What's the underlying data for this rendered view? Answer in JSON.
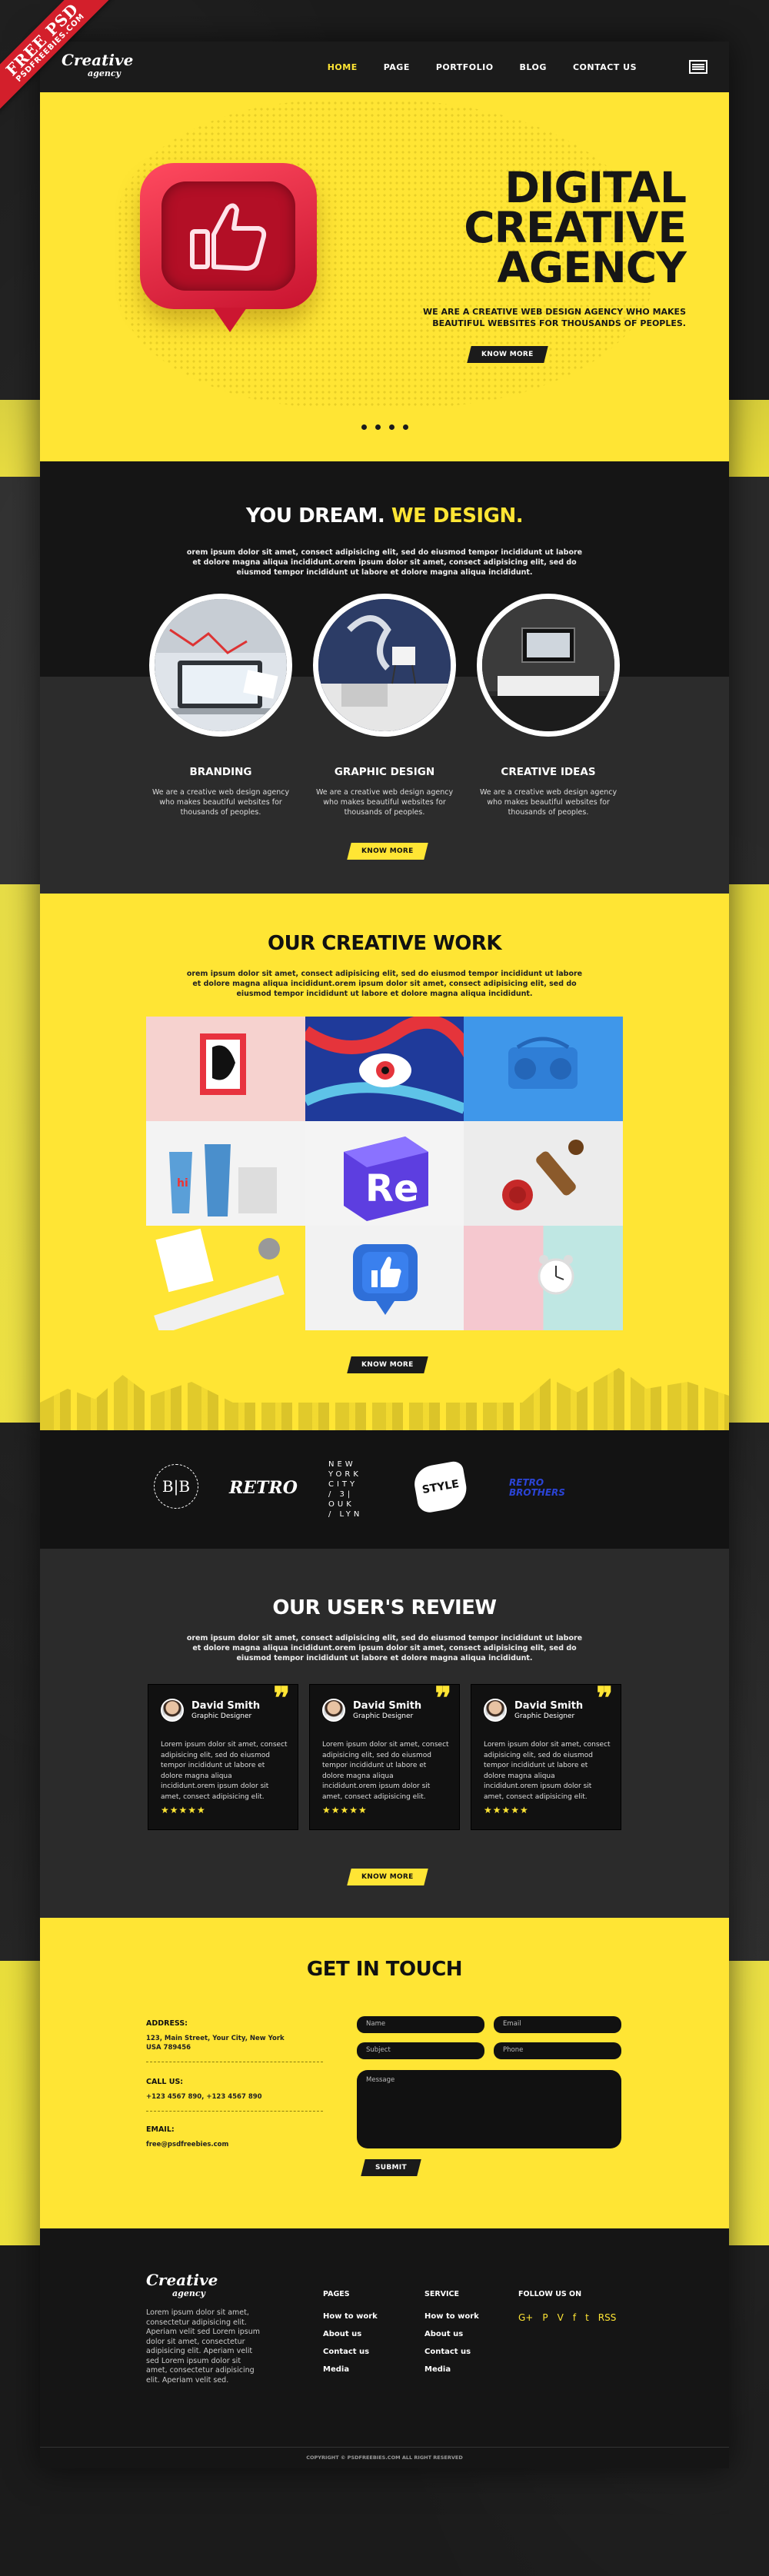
{
  "ribbon": {
    "line1": "FREE PSD",
    "line2": "PSDFREEBIES.COM"
  },
  "nav": {
    "logo_top": "Creative",
    "logo_bottom": "agency",
    "items": [
      "HOME",
      "PAGE",
      "PORTFOLIO",
      "BLOG",
      "CONTACT US"
    ],
    "active": "HOME"
  },
  "hero": {
    "title_lines": [
      "DIGITAL",
      "CREATIVE",
      "AGENCY"
    ],
    "subtitle_line1": "WE ARE A CREATIVE WEB DESIGN AGENCY WHO MAKES",
    "subtitle_line2": "BEAUTIFUL WEBSITES FOR THOUSANDS OF PEOPLES.",
    "button": "KNOW MORE",
    "slide_count": 4
  },
  "dream": {
    "title_a": "YOU DREAM.",
    "title_b": "WE DESIGN.",
    "paragraph": "orem ipsum dolor sit amet, consect adipisicing elit, sed do eiusmod tempor incididunt ut labore et dolore magna aliqua incididunt.orem ipsum dolor sit amet, consect adipisicing elit, sed do eiusmod tempor incididunt ut labore et dolore magna aliqua incididunt.",
    "services": [
      {
        "title": "BRANDING",
        "desc": "We are a creative web design agency who makes beautiful websites for thousands of peoples."
      },
      {
        "title": "GRAPHIC DESIGN",
        "desc": "We are a creative web design agency who makes beautiful websites for thousands of peoples."
      },
      {
        "title": "CREATIVE IDEAS",
        "desc": "We are a creative web design agency who makes beautiful websites for thousands of peoples."
      }
    ],
    "button": "KNOW MORE"
  },
  "work": {
    "title": "OUR CREATIVE WORK",
    "paragraph": "orem ipsum dolor sit amet, consect adipisicing elit, sed do eiusmod tempor incididunt ut labore et dolore magna aliqua incididunt.orem ipsum dolor sit amet, consect adipisicing elit, sed do eiusmod tempor incididunt ut labore et dolore magna aliqua incididunt.",
    "button": "KNOW MORE",
    "tile_re": "Re"
  },
  "brands": {
    "b1": "B|B",
    "b2": "RETRO",
    "b3_lines": [
      "NEW",
      "YORK",
      "CITY",
      "/ 3|",
      "OUK",
      "/ LYN"
    ],
    "b4": "STYLE",
    "b5_line1": "RETRO",
    "b5_line2": "BROTHERS"
  },
  "review": {
    "title": "OUR USER'S REVIEW",
    "paragraph": "orem ipsum dolor sit amet, consect adipisicing elit, sed do eiusmod tempor incididunt ut labore et dolore magna aliqua incididunt.orem ipsum dolor sit amet, consect adipisicing elit, sed do eiusmod tempor incididunt ut labore et dolore magna aliqua incididunt.",
    "cards": [
      {
        "name": "David Smith",
        "role": "Graphic Designer",
        "text": "Lorem ipsum dolor sit amet, consect adipisicing elit, sed do eiusmod tempor incididunt ut labore et dolore magna aliqua incididunt.orem ipsum dolor sit amet, consect adipisicing elit.",
        "stars": "★★★★★"
      },
      {
        "name": "David Smith",
        "role": "Graphic Designer",
        "text": "Lorem ipsum dolor sit amet, consect adipisicing elit, sed do eiusmod tempor incididunt ut labore et dolore magna aliqua incididunt.orem ipsum dolor sit amet, consect adipisicing elit.",
        "stars": "★★★★★"
      },
      {
        "name": "David Smith",
        "role": "Graphic Designer",
        "text": "Lorem ipsum dolor sit amet, consect adipisicing elit, sed do eiusmod tempor incididunt ut labore et dolore magna aliqua incididunt.orem ipsum dolor sit amet, consect adipisicing elit.",
        "stars": "★★★★★"
      }
    ],
    "button": "KNOW MORE"
  },
  "contact": {
    "title": "GET IN TOUCH",
    "address_label": "ADDRESS:",
    "address_line1": "123, Main Street, Your City, New York",
    "address_line2": "USA 789456",
    "call_label": "CALL US:",
    "call_value": "+123 4567 890, +123 4567 890",
    "email_label": "EMAIL:",
    "email_value": "free@psdfreebies.com",
    "placeholders": {
      "name": "Name",
      "email": "Email",
      "subject": "Subject",
      "phone": "Phone",
      "message": "Message"
    },
    "submit": "SUBMIT"
  },
  "footer": {
    "logo_top": "Creative",
    "logo_bottom": "agency",
    "text": "Lorem ipsum dolor sit amet, consectetur adipisicing elit. Aperiam velit sed Lorem ipsum dolor sit amet, consectetur adipisicing elit. Aperiam velit sed Lorem ipsum dolor sit amet, consectetur adipisicing elit. Aperiam velit sed.",
    "pages_title": "PAGES",
    "pages": [
      "How to work",
      "About us",
      "Contact us",
      "Media"
    ],
    "service_title": "SERVICE",
    "service": [
      "How to work",
      "About us",
      "Contact us",
      "Media"
    ],
    "follow_title": "FOLLOW US ON",
    "social": [
      "G+",
      "P",
      "V",
      "f",
      "t",
      "RSS"
    ],
    "copyright": "COPYRIGHT © PSDFREEBIES.COM ALL RIGHT RESERVED"
  },
  "colors": {
    "accent": "#ffe534",
    "dark": "#1b1b1b",
    "hero_like": "#d9142f"
  }
}
